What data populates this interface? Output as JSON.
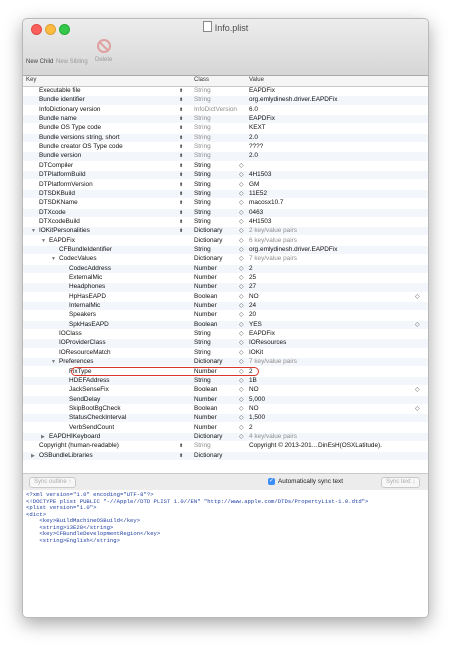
{
  "window": {
    "title": "Info.plist"
  },
  "toolbar": {
    "new_child": "New Child",
    "new_sibling": "New Sibling",
    "delete": "Delete"
  },
  "columns": {
    "key": "Key",
    "class": "Class",
    "value": "Value"
  },
  "rows": [
    {
      "key": "Executable file",
      "indent": 0,
      "triangle": "",
      "class": "String",
      "class_grey": true,
      "value": "EAPDFix",
      "stepper": "key"
    },
    {
      "key": "Bundle identifier",
      "indent": 0,
      "triangle": "",
      "class": "String",
      "class_grey": true,
      "value": "org.emlydinesh.driver.EAPDFix",
      "stepper": "key"
    },
    {
      "key": "InfoDictionary version",
      "indent": 0,
      "triangle": "",
      "class": "InfoDictVersion",
      "class_grey": true,
      "value": "6.0",
      "stepper": "key"
    },
    {
      "key": "Bundle name",
      "indent": 0,
      "triangle": "",
      "class": "String",
      "class_grey": true,
      "value": "EAPDFix",
      "stepper": "key"
    },
    {
      "key": "Bundle OS Type code",
      "indent": 0,
      "triangle": "",
      "class": "String",
      "class_grey": true,
      "value": "KEXT",
      "stepper": "key"
    },
    {
      "key": "Bundle versions string, short",
      "indent": 0,
      "triangle": "",
      "class": "String",
      "class_grey": true,
      "value": "2.0",
      "stepper": "key"
    },
    {
      "key": "Bundle creator OS Type code",
      "indent": 0,
      "triangle": "",
      "class": "String",
      "class_grey": true,
      "value": "????",
      "stepper": "key"
    },
    {
      "key": "Bundle version",
      "indent": 0,
      "triangle": "",
      "class": "String",
      "class_grey": true,
      "value": "2.0",
      "stepper": "key"
    },
    {
      "key": "DTCompiler",
      "indent": 0,
      "triangle": "",
      "class": "String",
      "class_grey": false,
      "value": "",
      "stepper": "both"
    },
    {
      "key": "DTPlatformBuild",
      "indent": 0,
      "triangle": "",
      "class": "String",
      "class_grey": false,
      "value": "4H1503",
      "stepper": "both"
    },
    {
      "key": "DTPlatformVersion",
      "indent": 0,
      "triangle": "",
      "class": "String",
      "class_grey": false,
      "value": "GM",
      "stepper": "both"
    },
    {
      "key": "DTSDKBuild",
      "indent": 0,
      "triangle": "",
      "class": "String",
      "class_grey": false,
      "value": "11E52",
      "stepper": "both"
    },
    {
      "key": "DTSDKName",
      "indent": 0,
      "triangle": "",
      "class": "String",
      "class_grey": false,
      "value": "macosx10.7",
      "stepper": "both"
    },
    {
      "key": "DTXcode",
      "indent": 0,
      "triangle": "",
      "class": "String",
      "class_grey": false,
      "value": "0463",
      "stepper": "both"
    },
    {
      "key": "DTXcodeBuild",
      "indent": 0,
      "triangle": "",
      "class": "String",
      "class_grey": false,
      "value": "4H1503",
      "stepper": "both"
    },
    {
      "key": "IOKitPersonalities",
      "indent": 0,
      "triangle": "down",
      "class": "Dictionary",
      "class_grey": false,
      "value": "2 key/value pairs",
      "value_grey": true,
      "stepper": "both"
    },
    {
      "key": "EAPDFix",
      "indent": 1,
      "triangle": "down",
      "class": "Dictionary",
      "class_grey": false,
      "value": "6 key/value pairs",
      "value_grey": true,
      "stepper": "value"
    },
    {
      "key": "CFBundleIdentifier",
      "indent": 2,
      "triangle": "",
      "class": "String",
      "class_grey": false,
      "value": "org.emlydinesh.driver.EAPDFix",
      "stepper": "value"
    },
    {
      "key": "CodecValues",
      "indent": 2,
      "triangle": "down",
      "class": "Dictionary",
      "class_grey": false,
      "value": "7 key/value pairs",
      "value_grey": true,
      "stepper": "value"
    },
    {
      "key": "CodecAddress",
      "indent": 3,
      "triangle": "",
      "class": "Number",
      "class_grey": false,
      "value": "2",
      "stepper": "value"
    },
    {
      "key": "ExternalMic",
      "indent": 3,
      "triangle": "",
      "class": "Number",
      "class_grey": false,
      "value": "25",
      "stepper": "value"
    },
    {
      "key": "Headphones",
      "indent": 3,
      "triangle": "",
      "class": "Number",
      "class_grey": false,
      "value": "27",
      "stepper": "value"
    },
    {
      "key": "HpHasEAPD",
      "indent": 3,
      "triangle": "",
      "class": "Boolean",
      "class_grey": false,
      "value": "NO",
      "stepper": "value",
      "dropdown": true
    },
    {
      "key": "InternalMic",
      "indent": 3,
      "triangle": "",
      "class": "Number",
      "class_grey": false,
      "value": "24",
      "stepper": "value"
    },
    {
      "key": "Speakers",
      "indent": 3,
      "triangle": "",
      "class": "Number",
      "class_grey": false,
      "value": "20",
      "stepper": "value"
    },
    {
      "key": "SpkHasEAPD",
      "indent": 3,
      "triangle": "",
      "class": "Boolean",
      "class_grey": false,
      "value": "YES",
      "stepper": "value",
      "dropdown": true
    },
    {
      "key": "IOClass",
      "indent": 2,
      "triangle": "",
      "class": "String",
      "class_grey": false,
      "value": "EAPDFix",
      "stepper": "value"
    },
    {
      "key": "IOProviderClass",
      "indent": 2,
      "triangle": "",
      "class": "String",
      "class_grey": false,
      "value": "IOResources",
      "stepper": "value"
    },
    {
      "key": "IOResourceMatch",
      "indent": 2,
      "triangle": "",
      "class": "String",
      "class_grey": false,
      "value": "IOKit",
      "stepper": "value"
    },
    {
      "key": "Preferences",
      "indent": 2,
      "triangle": "down",
      "class": "Dictionary",
      "class_grey": false,
      "value": "7 key/value pairs",
      "value_grey": true,
      "stepper": "value"
    },
    {
      "key": "FixType",
      "indent": 3,
      "triangle": "",
      "class": "Number",
      "class_grey": false,
      "value": "2",
      "stepper": "value",
      "highlight": true
    },
    {
      "key": "HDEFAddress",
      "indent": 3,
      "triangle": "",
      "class": "String",
      "class_grey": false,
      "value": "1B",
      "stepper": "value"
    },
    {
      "key": "JackSenseFix",
      "indent": 3,
      "triangle": "",
      "class": "Boolean",
      "class_grey": false,
      "value": "NO",
      "stepper": "value",
      "dropdown": true
    },
    {
      "key": "SendDelay",
      "indent": 3,
      "triangle": "",
      "class": "Number",
      "class_grey": false,
      "value": "5,000",
      "stepper": "value"
    },
    {
      "key": "SkipBootBgCheck",
      "indent": 3,
      "triangle": "",
      "class": "Boolean",
      "class_grey": false,
      "value": "NO",
      "stepper": "value",
      "dropdown": true
    },
    {
      "key": "StatusCheckInterval",
      "indent": 3,
      "triangle": "",
      "class": "Number",
      "class_grey": false,
      "value": "1,500",
      "stepper": "value"
    },
    {
      "key": "VerbSendCount",
      "indent": 3,
      "triangle": "",
      "class": "Number",
      "class_grey": false,
      "value": "2",
      "stepper": "value"
    },
    {
      "key": "EAPDHIKeyboard",
      "indent": 1,
      "triangle": "right",
      "class": "Dictionary",
      "class_grey": false,
      "value": "4 key/value pairs",
      "value_grey": true,
      "stepper": "value"
    },
    {
      "key": "Copyright (human-readable)",
      "indent": 0,
      "triangle": "",
      "class": "String",
      "class_grey": true,
      "value": "Copyright © 2013-201…DinEsH(OSXLatitude).",
      "stepper": "key"
    },
    {
      "key": "OSBundleLibraries",
      "indent": 0,
      "triangle": "right",
      "class": "Dictionary",
      "class_grey": false,
      "value": "",
      "stepper": "key"
    }
  ],
  "sync": {
    "outline_btn": "Sync outline ↑",
    "auto_label": "Automatically sync text",
    "text_btn": "Sync text ↓"
  },
  "xml": [
    "<?xml version=\"1.0\" encoding=\"UTF-8\"?>",
    "<!DOCTYPE plist PUBLIC \"-//Apple//DTD PLIST 1.0//EN\" \"http://www.apple.com/DTDs/PropertyList-1.0.dtd\">",
    "<plist version=\"1.0\">",
    "<dict>",
    "    <key>BuildMachineOSBuild</key>",
    "    <string>13E28</string>",
    "    <key>CFBundleDevelopmentRegion</key>",
    "    <string>English</string>"
  ],
  "colors": {
    "highlight": "#d8382c",
    "checkbox": "#3d8df5",
    "xml_text": "#1f3fa3"
  }
}
